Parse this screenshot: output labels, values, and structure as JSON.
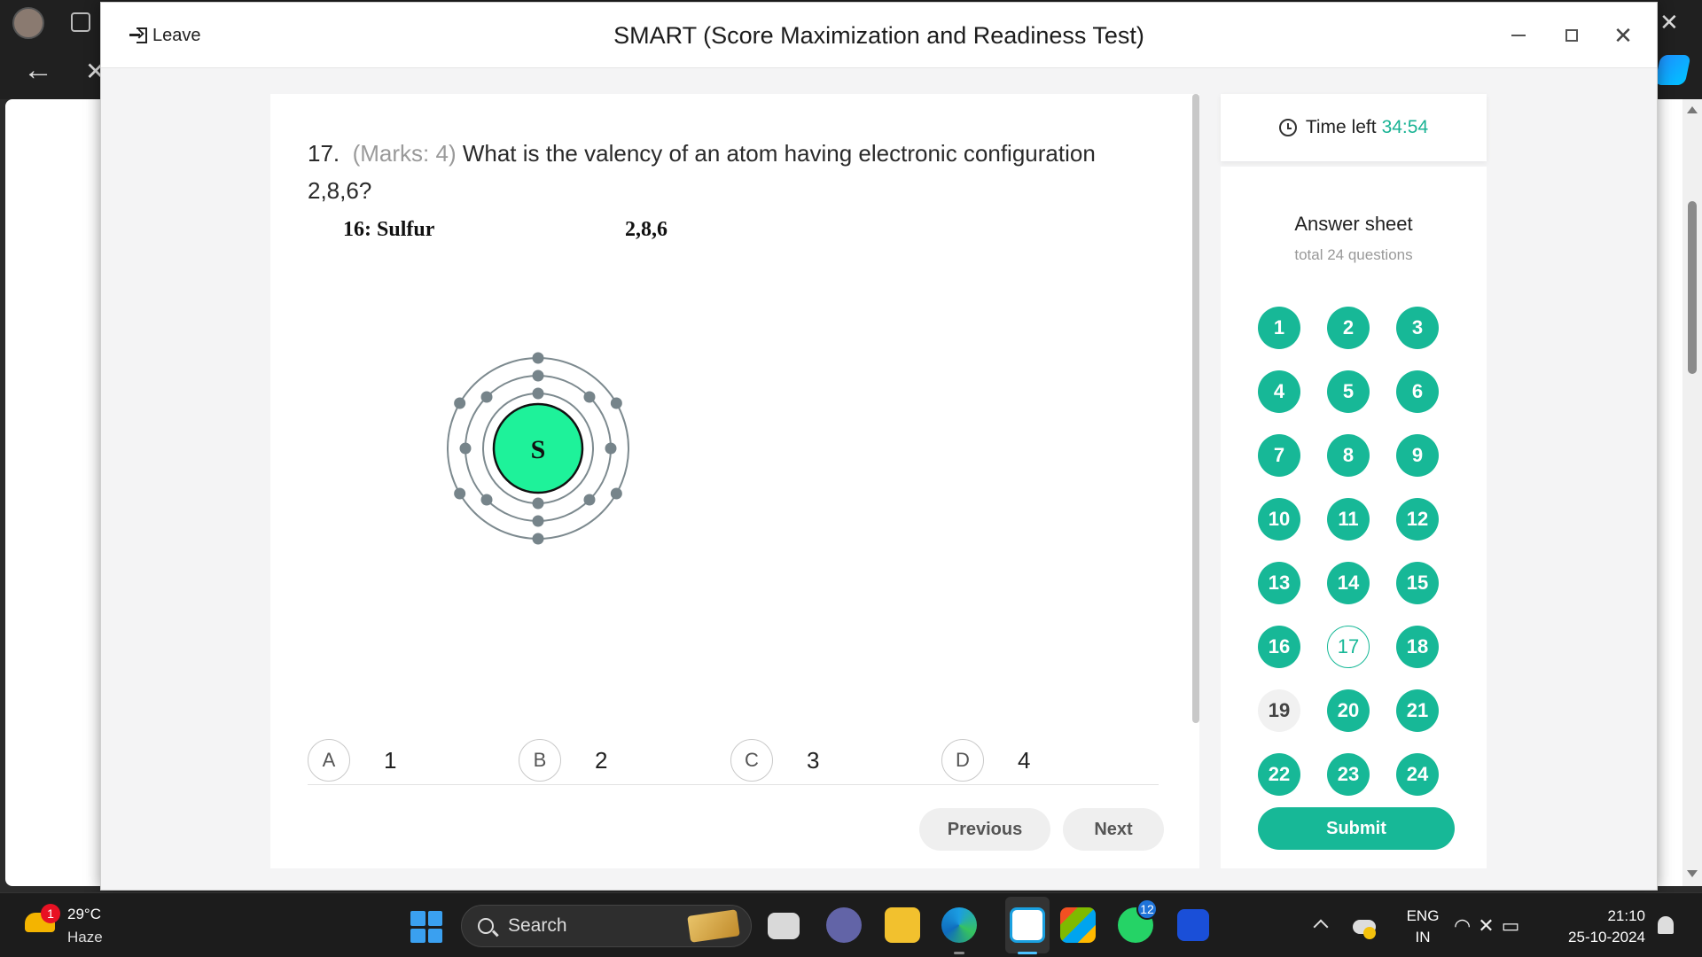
{
  "dialog": {
    "leave_label": "Leave",
    "title": "SMART (Score Maximization and Readiness Test)"
  },
  "question": {
    "number": "17.",
    "marks": "(Marks: 4)",
    "text": "What is the valency of an atom having electronic configuration 2,8,6?",
    "image": {
      "element_label": "16: Sulfur",
      "config_label": "2,8,6",
      "atom_symbol": "S",
      "shells": [
        2,
        8,
        6
      ],
      "nucleus_color": "#1ef29a"
    },
    "options": [
      {
        "letter": "A",
        "value": "1"
      },
      {
        "letter": "B",
        "value": "2"
      },
      {
        "letter": "C",
        "value": "3"
      },
      {
        "letter": "D",
        "value": "4"
      }
    ]
  },
  "nav": {
    "previous_label": "Previous",
    "next_label": "Next"
  },
  "timer": {
    "label": "Time left",
    "value": "34:54"
  },
  "answer_sheet": {
    "title": "Answer sheet",
    "subtitle": "total 24 questions",
    "current": 17,
    "unanswered": [
      19
    ],
    "questions": [
      "1",
      "2",
      "3",
      "4",
      "5",
      "6",
      "7",
      "8",
      "9",
      "10",
      "11",
      "12",
      "13",
      "14",
      "15",
      "16",
      "17",
      "18",
      "19",
      "20",
      "21",
      "22",
      "23",
      "24"
    ],
    "submit_label": "Submit",
    "accent_color": "#17b897"
  },
  "taskbar": {
    "weather_badge": "1",
    "temperature": "29°C",
    "weather": "Haze",
    "search_label": "Search",
    "whatsapp_badge": "12",
    "language_top": "ENG",
    "language_bottom": "IN",
    "time": "21:10",
    "date": "25-10-2024"
  }
}
